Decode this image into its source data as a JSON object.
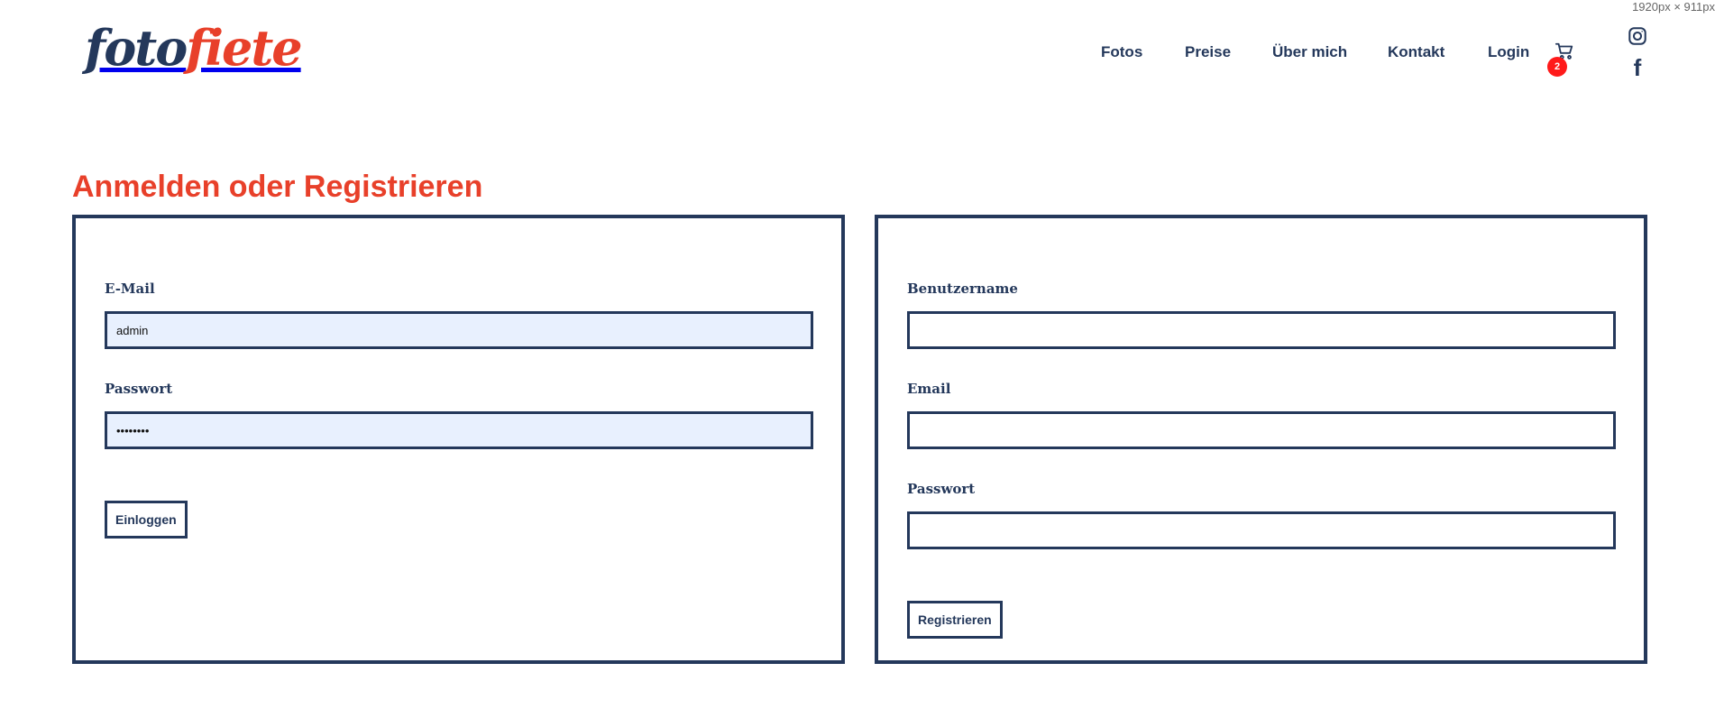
{
  "screen": {
    "size_label": "1920px × 911px"
  },
  "brand": {
    "logo_part1": "foto",
    "logo_part2": "fiete"
  },
  "nav": {
    "items": [
      {
        "label": "Fotos"
      },
      {
        "label": "Preise"
      },
      {
        "label": "Über mich"
      },
      {
        "label": "Kontakt"
      },
      {
        "label": "Login"
      }
    ],
    "cart_count": "2",
    "icons": [
      "cart-icon",
      "instagram-icon",
      "facebook-icon"
    ],
    "facebook_glyph": "f"
  },
  "page": {
    "title": "Anmelden oder Registrieren"
  },
  "login": {
    "email_label": "E-Mail",
    "email_value": "admin",
    "password_label": "Passwort",
    "password_value": "••••••••",
    "submit_label": "Einloggen"
  },
  "register": {
    "username_label": "Benutzername",
    "username_value": "",
    "email_label": "Email",
    "email_value": "",
    "password_label": "Passwort",
    "password_value": "",
    "submit_label": "Registrieren"
  },
  "colors": {
    "navy": "#24385b",
    "accent": "#e8402a",
    "badge": "#ff1a1a",
    "autofill": "#e8f0fe"
  }
}
